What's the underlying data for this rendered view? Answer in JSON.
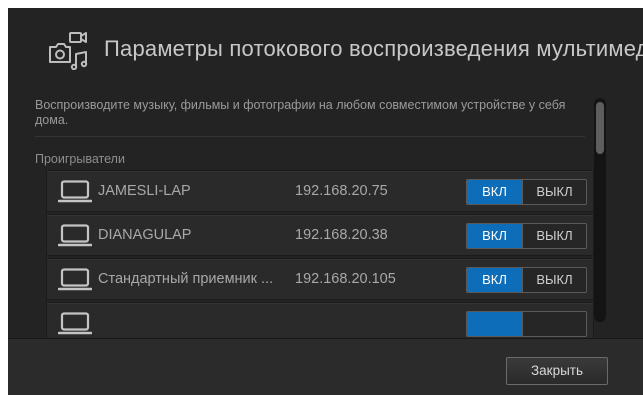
{
  "dialog": {
    "title": "Параметры потокового воспроизведения мультимедиа",
    "icon": "media-streaming-icon",
    "description": "Воспроизводите музыку, фильмы и фотографии на любом совместимом устройстве у себя дома.",
    "players_label": "Проигрыватели"
  },
  "players": [
    {
      "name": "JAMESLI-LAP",
      "ip": "192.168.20.75",
      "on_label": "ВКЛ",
      "off_label": "ВЫКЛ",
      "state": "on",
      "icon": "laptop-icon"
    },
    {
      "name": "DIANAGULAP",
      "ip": "192.168.20.38",
      "on_label": "ВКЛ",
      "off_label": "ВЫКЛ",
      "state": "on",
      "icon": "laptop-icon"
    },
    {
      "name": "Стандартный приемник ...",
      "ip": "192.168.20.105",
      "on_label": "ВКЛ",
      "off_label": "ВЫКЛ",
      "state": "on",
      "icon": "laptop-icon"
    },
    {
      "name": "",
      "ip": "",
      "on_label": "",
      "off_label": "",
      "state": "on",
      "icon": "laptop-icon"
    }
  ],
  "footer": {
    "close_label": "Закрыть"
  },
  "colors": {
    "dialog_bg": "#232323",
    "row_bg": "#2a2a2a",
    "accent_on": "#0d6db8",
    "text": "#a8a8a8"
  }
}
